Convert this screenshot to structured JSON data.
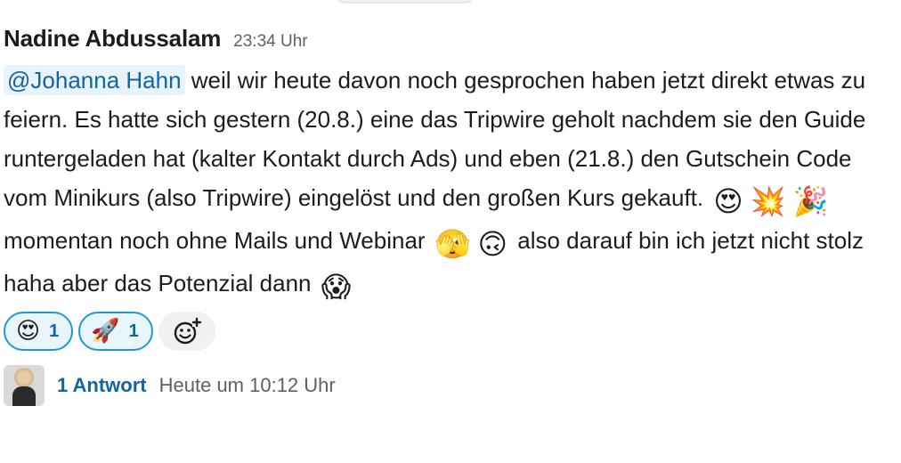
{
  "message": {
    "author": "Nadine Abdussalam",
    "timestamp": "23:34 Uhr",
    "mention": "@Johanna Hahn",
    "text_1": " weil wir heute davon noch gesprochen haben jetzt direkt etwas zu feiern. Es hatte sich gestern (20.8.) eine das Tripwire geholt nachdem sie den Guide runtergeladen hat (kalter Kontakt durch Ads) und eben (21.8.) den Gutschein Code vom Minikurs (also Tripwire) eingelöst und den großen Kurs gekauft.",
    "emoji_1": "😍",
    "emoji_2": "💥",
    "emoji_3": "🎉",
    "text_2": "momentan noch ohne Mails und Webinar",
    "emoji_4": "🫣",
    "emoji_5": "🙃",
    "text_3": " also darauf bin ich jetzt nicht stolz haha aber das Potenzial dann",
    "emoji_6": "😱"
  },
  "reactions": [
    {
      "emoji": "😍",
      "count": "1"
    },
    {
      "emoji": "🚀",
      "count": "1"
    }
  ],
  "thread": {
    "reply_count": "1 Antwort",
    "last_reply": "Heute um 10:12 Uhr"
  },
  "colors": {
    "mention_bg": "#e8f3fb",
    "link": "#1264a3",
    "reaction_border": "#1d9bd1"
  },
  "icons": {
    "add_reaction": "add-reaction-icon"
  }
}
